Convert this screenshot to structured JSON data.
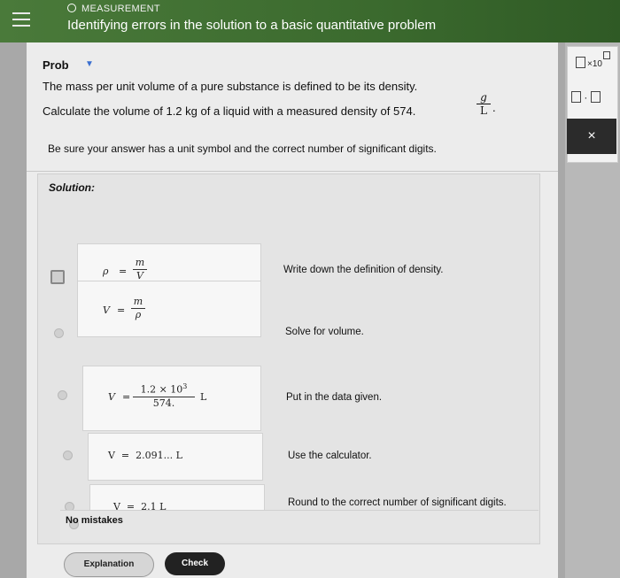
{
  "header": {
    "category": "MEASUREMENT",
    "topic": "Identifying errors in the solution to a basic quantitative problem"
  },
  "problem": {
    "label": "Prob",
    "line1": "The mass per unit volume of a pure substance is defined to be its density.",
    "line2": "Calculate the volume of 1.2 kg of a liquid with a measured density of 574.",
    "unit_num": "g",
    "unit_den": "L",
    "unit_tail": ".",
    "note": "Be sure your answer has a unit symbol and the correct number of significant digits."
  },
  "solution": {
    "title": "Solution:",
    "steps": [
      {
        "lhs": "ρ",
        "eq": "=",
        "num": "m",
        "den": "V",
        "text": "Write down the definition of density."
      },
      {
        "lhs": "V",
        "eq": "=",
        "num": "m",
        "den": "ρ",
        "text": "Solve for volume."
      },
      {
        "lhs": "V",
        "eq": "=",
        "num": "1.2 × 10",
        "sup": "3",
        "den": "574.",
        "unit": "L",
        "text": "Put in the data given."
      },
      {
        "expr": "V  =  2.091... L",
        "text": "Use the calculator."
      },
      {
        "expr": "V  =  2.1 L",
        "text": "Round to the correct number of significant digits."
      }
    ],
    "no_mistakes": "No mistakes"
  },
  "buttons": {
    "explanation": "Explanation",
    "check": "Check"
  },
  "toolbar": {
    "x10": "×10",
    "dot": "·",
    "close": "×"
  }
}
